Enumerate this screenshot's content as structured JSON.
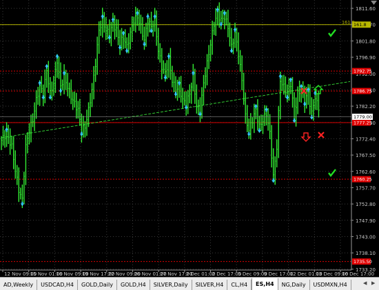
{
  "chart_data": {
    "type": "line",
    "symbol": "ES,H4",
    "ylim": [
      1732.95,
      1814.1
    ],
    "y_ticks": [
      "1811.60",
      "1806.70",
      "1801.80",
      "1796.90",
      "1792.00",
      "1787.10",
      "1782.20",
      "1777.30",
      "1772.40",
      "1767.50",
      "1762.60",
      "1757.70",
      "1752.80",
      "1747.90",
      "1743.00",
      "1738.10",
      "1733.20"
    ],
    "x_labels": [
      "12 Nov 09:00",
      "15 Nov 01:00",
      "16 Nov 09:00",
      "19 Nov 17:00",
      "22 Nov 09:00",
      "26 Nov 01:00",
      "27 Nov 17:00",
      "2 Dec 01:00",
      "2 Dec 17:00",
      "5 Dec 09:00",
      "9 Dec 17:00",
      "12 Dec 01:00",
      "13 Dec 09:00",
      "16 Dec 17:00"
    ],
    "current_price": "1779.00",
    "levels": [
      {
        "label": "161.8",
        "price": 1806.7,
        "color": "#b8b800",
        "style": "solid",
        "tag_color": "#b8b800",
        "tag_text_color": "#000000"
      },
      {
        "label": "1792.75",
        "price": 1792.75,
        "color": "#e00000",
        "style": "dotted",
        "tag_color": "#e00000",
        "tag_text_color": "#ffffff"
      },
      {
        "label": "1786.75",
        "price": 1786.75,
        "color": "#e00000",
        "style": "dotted",
        "tag_color": "#e00000",
        "tag_text_color": "#ffffff"
      },
      {
        "label": "1777.25",
        "price": 1777.25,
        "color": "#e00000",
        "style": "solid",
        "tag_color": "#e00000",
        "tag_text_color": "#ffffff"
      },
      {
        "label": "1760.25",
        "price": 1760.25,
        "color": "#e00000",
        "style": "dotted",
        "tag_color": "#e00000",
        "tag_text_color": "#ffffff"
      },
      {
        "label": "1735.50",
        "price": 1735.5,
        "color": "#e00000",
        "style": "dotted",
        "tag_color": "#e00000",
        "tag_text_color": "#ffffff"
      }
    ],
    "trendline": {
      "from": [
        0,
        1772.7
      ],
      "to": [
        200,
        1789.6
      ],
      "color": "#33cc33",
      "style": "dashed"
    },
    "price_color": "#33ee33",
    "fractal_color": "#33ccff",
    "grid": true,
    "signals": [
      {
        "type": "check",
        "color": "#22dd22"
      },
      {
        "type": "cross",
        "color": "#ff2222"
      },
      {
        "type": "up-arrow",
        "color": "#22dd22"
      },
      {
        "type": "down-arrow",
        "color": "#ff2222"
      },
      {
        "type": "cross",
        "color": "#ff2222"
      },
      {
        "type": "check",
        "color": "#22dd22"
      }
    ],
    "pivot_prices": [
      [
        0,
        1772
      ],
      [
        3,
        1774
      ],
      [
        6,
        1770
      ],
      [
        8,
        1763
      ],
      [
        10,
        1757
      ],
      [
        12,
        1754
      ],
      [
        14,
        1770
      ],
      [
        16,
        1775
      ],
      [
        18,
        1778
      ],
      [
        20,
        1784
      ],
      [
        22,
        1788
      ],
      [
        24,
        1786
      ],
      [
        26,
        1793
      ],
      [
        28,
        1786
      ],
      [
        30,
        1789
      ],
      [
        32,
        1796
      ],
      [
        34,
        1788
      ],
      [
        36,
        1791
      ],
      [
        38,
        1788
      ],
      [
        40,
        1785
      ],
      [
        42,
        1783
      ],
      [
        44,
        1781
      ],
      [
        46,
        1775
      ],
      [
        48,
        1776
      ],
      [
        50,
        1781
      ],
      [
        52,
        1787
      ],
      [
        54,
        1795
      ],
      [
        56,
        1805
      ],
      [
        58,
        1808
      ],
      [
        60,
        1805
      ],
      [
        62,
        1804
      ],
      [
        64,
        1807
      ],
      [
        66,
        1805
      ],
      [
        68,
        1801
      ],
      [
        70,
        1803
      ],
      [
        72,
        1800
      ],
      [
        74,
        1804
      ],
      [
        76,
        1808
      ],
      [
        78,
        1809
      ],
      [
        80,
        1806
      ],
      [
        82,
        1802
      ],
      [
        84,
        1808
      ],
      [
        86,
        1806
      ],
      [
        88,
        1808
      ],
      [
        90,
        1799
      ],
      [
        92,
        1794
      ],
      [
        94,
        1792
      ],
      [
        96,
        1796
      ],
      [
        98,
        1790
      ],
      [
        100,
        1787
      ],
      [
        102,
        1788
      ],
      [
        104,
        1784
      ],
      [
        106,
        1783
      ],
      [
        108,
        1786
      ],
      [
        110,
        1791
      ],
      [
        112,
        1782
      ],
      [
        114,
        1781
      ],
      [
        116,
        1789
      ],
      [
        118,
        1795
      ],
      [
        120,
        1801
      ],
      [
        122,
        1807
      ],
      [
        124,
        1810
      ],
      [
        126,
        1808
      ],
      [
        128,
        1809
      ],
      [
        130,
        1806
      ],
      [
        132,
        1800
      ],
      [
        134,
        1804
      ],
      [
        136,
        1798
      ],
      [
        138,
        1790
      ],
      [
        140,
        1779
      ],
      [
        142,
        1775
      ],
      [
        144,
        1778
      ],
      [
        146,
        1781
      ],
      [
        148,
        1776
      ],
      [
        150,
        1778
      ],
      [
        152,
        1780
      ],
      [
        154,
        1774
      ],
      [
        156,
        1761
      ],
      [
        158,
        1770
      ],
      [
        160,
        1790
      ],
      [
        162,
        1788
      ],
      [
        164,
        1786
      ],
      [
        166,
        1789
      ],
      [
        168,
        1779
      ],
      [
        170,
        1786
      ],
      [
        172,
        1787
      ],
      [
        174,
        1784
      ],
      [
        176,
        1786
      ],
      [
        178,
        1780
      ],
      [
        180,
        1785
      ],
      [
        182,
        1781
      ]
    ]
  },
  "tabs": [
    {
      "label": "AD,Weekly",
      "active": false
    },
    {
      "label": "USDCAD,H4",
      "active": false
    },
    {
      "label": "GOLD,Daily",
      "active": false
    },
    {
      "label": "GOLD,H4",
      "active": false
    },
    {
      "label": "SILVER,Daily",
      "active": false
    },
    {
      "label": "SILVER,H4",
      "active": false
    },
    {
      "label": "CL,H4",
      "active": false
    },
    {
      "label": "ES,H4",
      "active": true
    },
    {
      "label": "NG,Daily",
      "active": false
    },
    {
      "label": "USDMXN,H4",
      "active": false
    }
  ],
  "icons": {
    "tab_scroll_left": "triangle-left",
    "tab_scroll_right": "triangle-right",
    "chart_shift": "triangle-down"
  }
}
